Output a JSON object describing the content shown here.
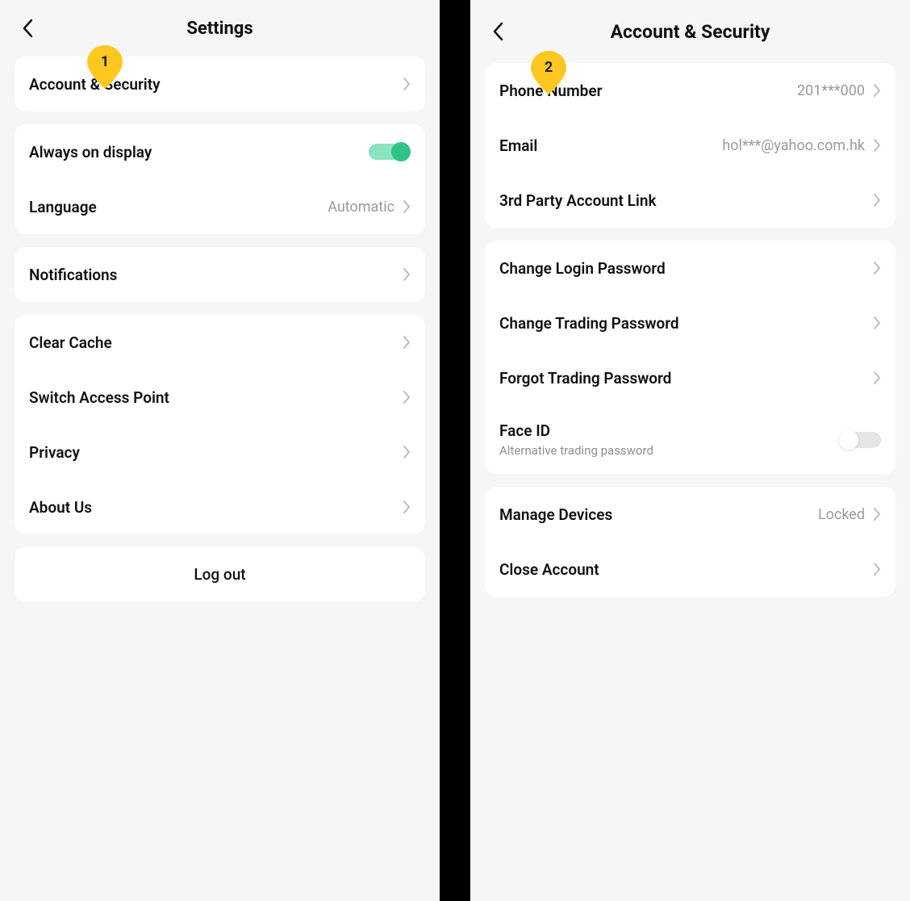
{
  "colors": {
    "accent": "#ffc821",
    "toggleOn": "#2fc487"
  },
  "pins": {
    "step1": "1",
    "step2": "2"
  },
  "left": {
    "title": "Settings",
    "groups": {
      "account": {
        "label": "Account & Security"
      },
      "display": {
        "always_on": {
          "label": "Always on display",
          "on": true
        },
        "language": {
          "label": "Language",
          "value": "Automatic"
        }
      },
      "notifications": {
        "label": "Notifications"
      },
      "system": {
        "clear_cache": {
          "label": "Clear Cache"
        },
        "access_point": {
          "label": "Switch Access Point"
        },
        "privacy": {
          "label": "Privacy"
        },
        "about": {
          "label": "About Us"
        }
      },
      "logout": {
        "label": "Log out"
      }
    }
  },
  "right": {
    "title": "Account & Security",
    "groups": {
      "identity": {
        "phone": {
          "label": "Phone Number",
          "value": "201***000"
        },
        "email": {
          "label": "Email",
          "value": "hol***@yahoo.com.hk"
        },
        "third_party": {
          "label": "3rd Party Account Link"
        }
      },
      "passwords": {
        "login": {
          "label": "Change Login Password"
        },
        "trading": {
          "label": "Change Trading Password"
        },
        "forgot": {
          "label": "Forgot Trading Password"
        },
        "faceid": {
          "label": "Face ID",
          "sub": "Alternative trading password",
          "on": false
        }
      },
      "devices": {
        "manage": {
          "label": "Manage Devices",
          "value": "Locked"
        },
        "close": {
          "label": "Close Account"
        }
      }
    }
  }
}
